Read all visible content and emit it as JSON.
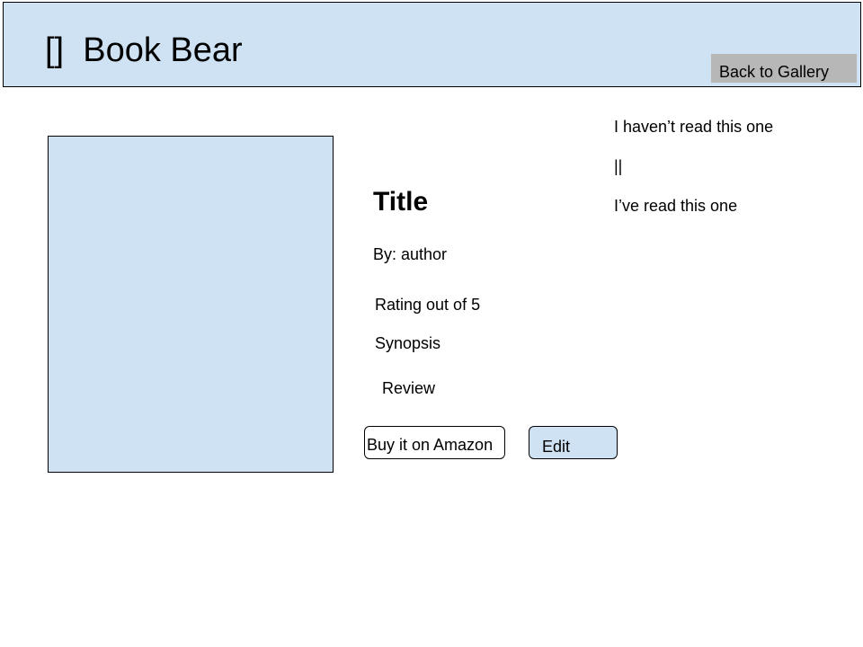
{
  "header": {
    "logo_icon": "[]",
    "app_name": "Book Bear",
    "back_label": "Back to Gallery"
  },
  "book": {
    "cover_icon": "book-cover-placeholder",
    "title": "Title",
    "author": "By: author",
    "rating": "Rating out of 5",
    "synopsis": "Synopsis",
    "review": "Review"
  },
  "read_status": {
    "unread_label": "I haven’t read this one",
    "toggle_label": "||",
    "read_label": "I’ve read this one"
  },
  "actions": {
    "amazon_label": "Buy it on Amazon",
    "edit_label": "Edit"
  },
  "colors": {
    "header_bg": "#cfe2f3",
    "cover_bg": "#cfe2f3",
    "back_button_bg": "#b7b7b7",
    "edit_button_bg": "#cfe2f3"
  }
}
